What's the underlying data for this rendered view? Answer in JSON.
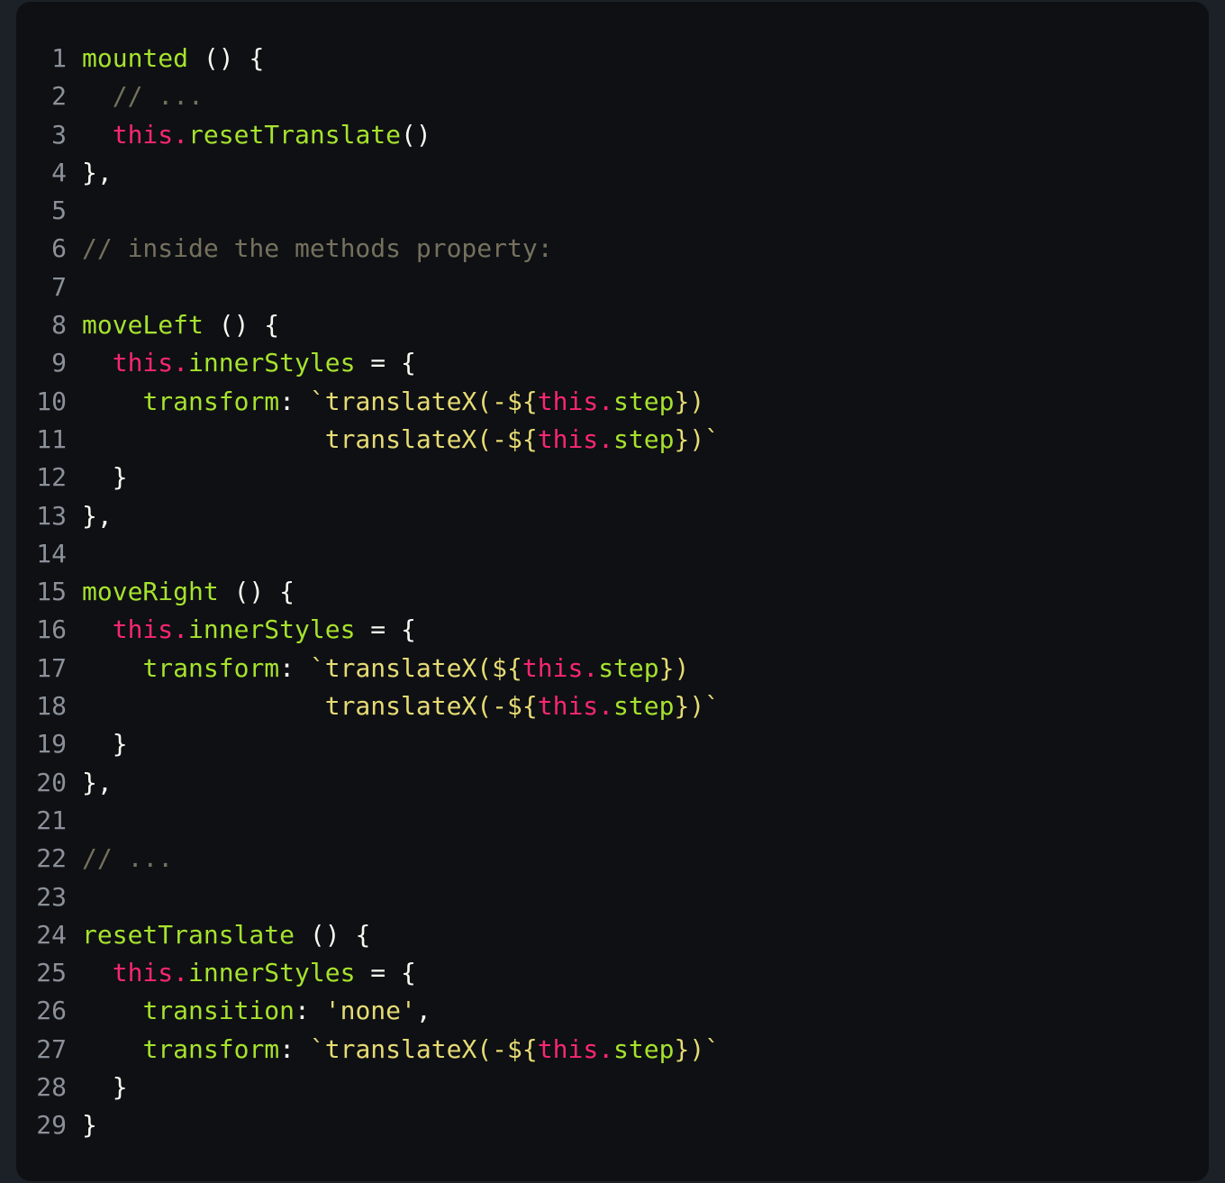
{
  "code_block": {
    "language": "javascript",
    "background": "#0e1013",
    "page_background": "#1c2128",
    "total_lines": 29,
    "palette": {
      "line_number": "#8b9099",
      "plain": "#f8f8f2",
      "function": "#a6e22e",
      "property": "#a6e22e",
      "keyword": "#f92672",
      "string": "#e6db74",
      "comment": "#75715e"
    },
    "lines": [
      {
        "number": "1",
        "text": "mounted () {",
        "tokens": [
          {
            "t": "mounted",
            "c": "func"
          },
          {
            "t": " () {",
            "c": "punct"
          }
        ]
      },
      {
        "number": "2",
        "text": "  // ...",
        "tokens": [
          {
            "t": "  ",
            "c": "plain"
          },
          {
            "t": "// ...",
            "c": "comment"
          }
        ]
      },
      {
        "number": "3",
        "text": "  this.resetTranslate()",
        "tokens": [
          {
            "t": "  ",
            "c": "plain"
          },
          {
            "t": "this",
            "c": "key"
          },
          {
            "t": ".",
            "c": "key"
          },
          {
            "t": "resetTranslate",
            "c": "func"
          },
          {
            "t": "()",
            "c": "punct"
          }
        ]
      },
      {
        "number": "4",
        "text": "},",
        "tokens": [
          {
            "t": "},",
            "c": "punct"
          }
        ]
      },
      {
        "number": "5",
        "text": "",
        "tokens": []
      },
      {
        "number": "6",
        "text": "// inside the methods property:",
        "tokens": [
          {
            "t": "// inside the methods property:",
            "c": "comment"
          }
        ]
      },
      {
        "number": "7",
        "text": "",
        "tokens": []
      },
      {
        "number": "8",
        "text": "moveLeft () {",
        "tokens": [
          {
            "t": "moveLeft",
            "c": "func"
          },
          {
            "t": " () {",
            "c": "punct"
          }
        ]
      },
      {
        "number": "9",
        "text": "  this.innerStyles = {",
        "tokens": [
          {
            "t": "  ",
            "c": "plain"
          },
          {
            "t": "this",
            "c": "key"
          },
          {
            "t": ".",
            "c": "key"
          },
          {
            "t": "innerStyles",
            "c": "prop"
          },
          {
            "t": " = {",
            "c": "punct"
          }
        ]
      },
      {
        "number": "10",
        "text": "    transform: `translateX(-${this.step})",
        "tokens": [
          {
            "t": "    ",
            "c": "plain"
          },
          {
            "t": "transform",
            "c": "prop"
          },
          {
            "t": ": ",
            "c": "punct"
          },
          {
            "t": "`translateX(-${",
            "c": "string"
          },
          {
            "t": "this",
            "c": "key"
          },
          {
            "t": ".",
            "c": "key"
          },
          {
            "t": "step",
            "c": "prop"
          },
          {
            "t": "})",
            "c": "string"
          }
        ]
      },
      {
        "number": "11",
        "text": "                translateX(-${this.step})`",
        "tokens": [
          {
            "t": "                ",
            "c": "plain"
          },
          {
            "t": "translateX(-${",
            "c": "string"
          },
          {
            "t": "this",
            "c": "key"
          },
          {
            "t": ".",
            "c": "key"
          },
          {
            "t": "step",
            "c": "prop"
          },
          {
            "t": "})`",
            "c": "string"
          }
        ]
      },
      {
        "number": "12",
        "text": "  }",
        "tokens": [
          {
            "t": "  }",
            "c": "punct"
          }
        ]
      },
      {
        "number": "13",
        "text": "},",
        "tokens": [
          {
            "t": "},",
            "c": "punct"
          }
        ]
      },
      {
        "number": "14",
        "text": "",
        "tokens": []
      },
      {
        "number": "15",
        "text": "moveRight () {",
        "tokens": [
          {
            "t": "moveRight",
            "c": "func"
          },
          {
            "t": " () {",
            "c": "punct"
          }
        ]
      },
      {
        "number": "16",
        "text": "  this.innerStyles = {",
        "tokens": [
          {
            "t": "  ",
            "c": "plain"
          },
          {
            "t": "this",
            "c": "key"
          },
          {
            "t": ".",
            "c": "key"
          },
          {
            "t": "innerStyles",
            "c": "prop"
          },
          {
            "t": " = {",
            "c": "punct"
          }
        ]
      },
      {
        "number": "17",
        "text": "    transform: `translateX(${this.step})",
        "tokens": [
          {
            "t": "    ",
            "c": "plain"
          },
          {
            "t": "transform",
            "c": "prop"
          },
          {
            "t": ": ",
            "c": "punct"
          },
          {
            "t": "`translateX(${",
            "c": "string"
          },
          {
            "t": "this",
            "c": "key"
          },
          {
            "t": ".",
            "c": "key"
          },
          {
            "t": "step",
            "c": "prop"
          },
          {
            "t": "})",
            "c": "string"
          }
        ]
      },
      {
        "number": "18",
        "text": "                translateX(-${this.step})`",
        "tokens": [
          {
            "t": "                ",
            "c": "plain"
          },
          {
            "t": "translateX(-${",
            "c": "string"
          },
          {
            "t": "this",
            "c": "key"
          },
          {
            "t": ".",
            "c": "key"
          },
          {
            "t": "step",
            "c": "prop"
          },
          {
            "t": "})`",
            "c": "string"
          }
        ]
      },
      {
        "number": "19",
        "text": "  }",
        "tokens": [
          {
            "t": "  }",
            "c": "punct"
          }
        ]
      },
      {
        "number": "20",
        "text": "},",
        "tokens": [
          {
            "t": "},",
            "c": "punct"
          }
        ]
      },
      {
        "number": "21",
        "text": "",
        "tokens": []
      },
      {
        "number": "22",
        "text": "// ...",
        "tokens": [
          {
            "t": "// ...",
            "c": "comment"
          }
        ]
      },
      {
        "number": "23",
        "text": "",
        "tokens": []
      },
      {
        "number": "24",
        "text": "resetTranslate () {",
        "tokens": [
          {
            "t": "resetTranslate",
            "c": "func"
          },
          {
            "t": " () {",
            "c": "punct"
          }
        ]
      },
      {
        "number": "25",
        "text": "  this.innerStyles = {",
        "tokens": [
          {
            "t": "  ",
            "c": "plain"
          },
          {
            "t": "this",
            "c": "key"
          },
          {
            "t": ".",
            "c": "key"
          },
          {
            "t": "innerStyles",
            "c": "prop"
          },
          {
            "t": " = {",
            "c": "punct"
          }
        ]
      },
      {
        "number": "26",
        "text": "    transition: 'none',",
        "tokens": [
          {
            "t": "    ",
            "c": "plain"
          },
          {
            "t": "transition",
            "c": "prop"
          },
          {
            "t": ": ",
            "c": "punct"
          },
          {
            "t": "'none'",
            "c": "string"
          },
          {
            "t": ",",
            "c": "punct"
          }
        ]
      },
      {
        "number": "27",
        "text": "    transform: `translateX(-${this.step})`",
        "tokens": [
          {
            "t": "    ",
            "c": "plain"
          },
          {
            "t": "transform",
            "c": "prop"
          },
          {
            "t": ": ",
            "c": "punct"
          },
          {
            "t": "`translateX(-${",
            "c": "string"
          },
          {
            "t": "this",
            "c": "key"
          },
          {
            "t": ".",
            "c": "key"
          },
          {
            "t": "step",
            "c": "prop"
          },
          {
            "t": "})`",
            "c": "string"
          }
        ]
      },
      {
        "number": "28",
        "text": "  }",
        "tokens": [
          {
            "t": "  }",
            "c": "punct"
          }
        ]
      },
      {
        "number": "29",
        "text": "}",
        "tokens": [
          {
            "t": "}",
            "c": "punct"
          }
        ]
      }
    ]
  }
}
